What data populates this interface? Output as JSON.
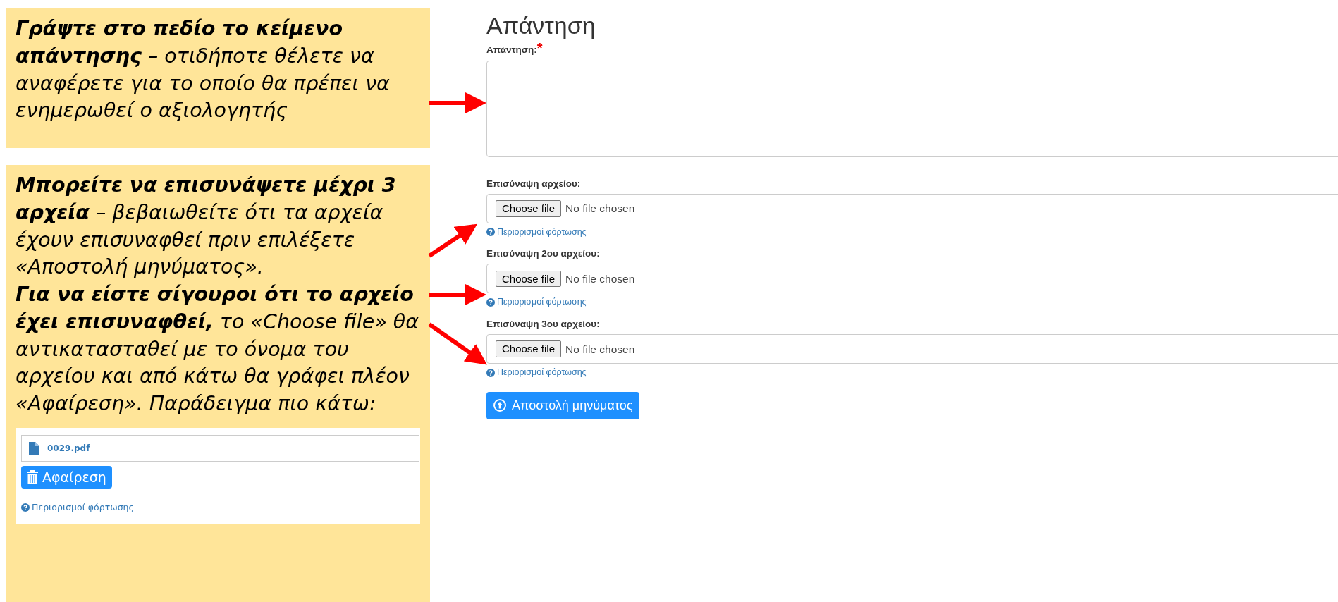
{
  "callouts": [
    {
      "paragraphs": [
        "**Γράψτε στο πεδίο το κείμενο απάντησης** – οτιδήποτε θέλετε να αναφέρετε για το οποίο θα πρέπει να ενημερωθεί ο αξιολογητής"
      ]
    },
    {
      "paragraphs": [
        "**Μπορείτε να επισυνάψετε μέχρι 3 αρχεία** – βεβαιωθείτε ότι τα αρχεία έχουν επισυναφθεί πριν επιλέξετε «Αποστολή μηνύματος».",
        "**Για να είστε σίγουροι ότι το αρχείο έχει επισυναφθεί,** το «Choose file» θα αντικατασταθεί με το όνομα του αρχείου και από κάτω θα γράφει πλέον «Αφαίρεση». Παράδειγμα πιο κάτω:"
      ],
      "example": {
        "file_name": "0029.pdf",
        "remove_button": "Αφαίρεση",
        "help_link": "Περιορισμοί φόρτωσης"
      }
    }
  ],
  "form": {
    "title": "Απάντηση",
    "answer_label": "Απάντηση:",
    "required_mark": "*",
    "attachments": [
      {
        "label": "Επισύναψη αρχείου:",
        "button": "Choose file",
        "status": "No file chosen",
        "help_link": "Περιορισμοί φόρτωσης"
      },
      {
        "label": "Επισύναψη 2ου αρχείου:",
        "button": "Choose file",
        "status": "No file chosen",
        "help_link": "Περιορισμοί φόρτωσης"
      },
      {
        "label": "Επισύναψη 3ου αρχείου:",
        "button": "Choose file",
        "status": "No file chosen",
        "help_link": "Περιορισμοί φόρτωσης"
      }
    ],
    "submit": "Αποστολή μηνύματος"
  }
}
